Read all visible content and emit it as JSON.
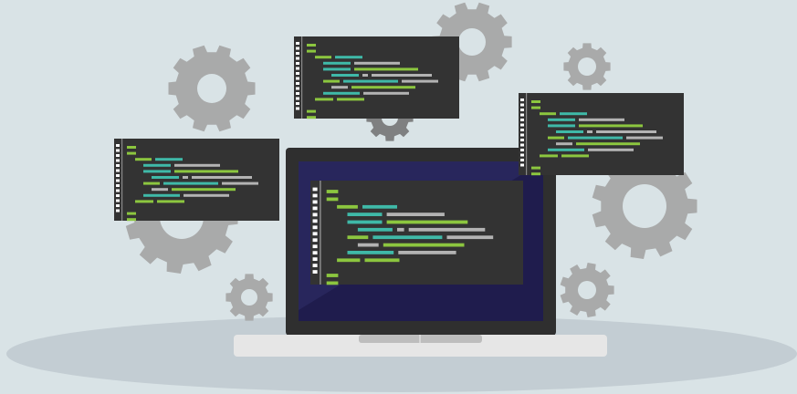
{
  "scene": {
    "subject": "laptop-with-code-windows-and-gears",
    "colors": {
      "background": "#d9e3e6",
      "floor_shadow": "#c3cdd3",
      "gear": "#a9aaaa",
      "gear_dark": "#7f8081",
      "code_window": "#333333",
      "code_gutter": "#ffffff",
      "code_green": "#8cc63f",
      "code_cyan": "#3fb9a8",
      "code_gray": "#b3b3b3",
      "laptop_bezel": "#2f2f2f",
      "laptop_screen": "#1f1c4d",
      "laptop_base": "#e6e6e6",
      "laptop_base_shadow": "#bdbdbd"
    },
    "icons": [
      "gear-icon",
      "code-window-icon",
      "laptop-icon"
    ]
  }
}
